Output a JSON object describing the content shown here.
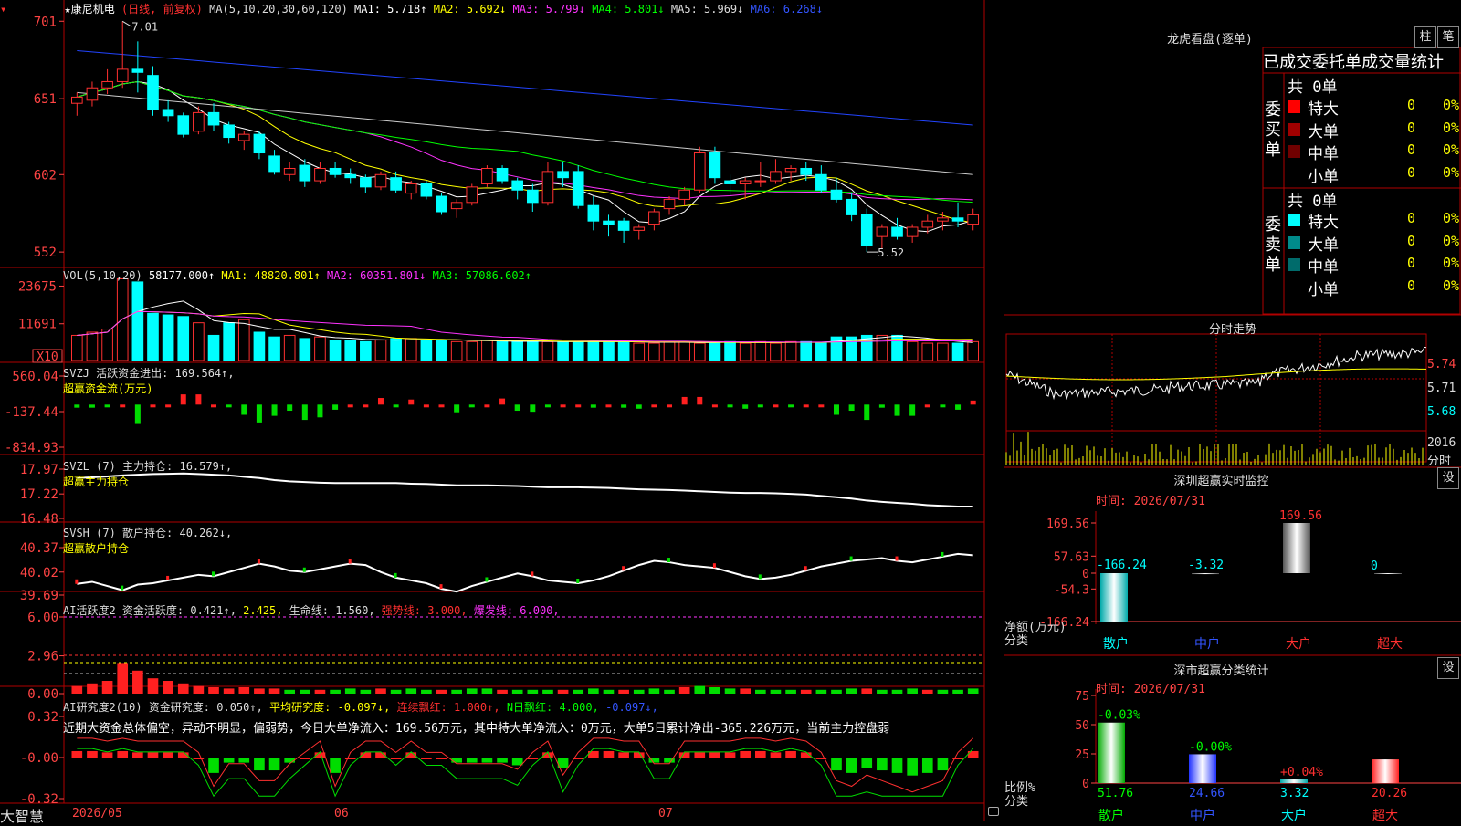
{
  "header": {
    "stock": "★康尼机电",
    "mode": "(日线, 前复权)",
    "ma_title": "MA(5,10,20,30,60,120)",
    "ma1": "MA1: 5.718↑",
    "ma2": "MA2: 5.692↓",
    "ma3": "MA3: 5.799↓",
    "ma4": "MA4: 5.801↓",
    "ma5": "MA5: 5.969↓",
    "ma6": "MA6: 6.268↓",
    "high_label": "7.01",
    "low_label": "5.52"
  },
  "price_axis": [
    "701",
    "651",
    "602",
    "552"
  ],
  "vol": {
    "title": "VOL(5,10,20)",
    "value": "58177.000↑",
    "ma1": "MA1: 48820.801↑",
    "ma2": "MA2: 60351.801↓",
    "ma3": "MA3: 57086.602↑",
    "axis": [
      "23675",
      "11691"
    ],
    "unit": "X10"
  },
  "svzj": {
    "title": "SVZJ  活跃资金进出: 169.564↑,",
    "sub": "超赢资金流(万元)",
    "axis": [
      "560.04",
      "-137.44",
      "-834.93"
    ]
  },
  "svzl": {
    "title": "SVZL (7) 主力持仓: 16.579↑,",
    "sub": "超赢主力持仓",
    "axis": [
      "17.97",
      "17.22",
      "16.48"
    ]
  },
  "svsh": {
    "title": "SVSH (7) 散户持仓: 40.262↓,",
    "sub": "超赢散户持仓",
    "axis": [
      "40.37",
      "40.02",
      "39.69"
    ]
  },
  "ai1": {
    "title": "AI活跃度2 资金活跃度: 0.421↑,",
    "v2": "2.425,",
    "life": "生命线: 1.560,",
    "strong": "强势线: 3.000,",
    "burst": "爆发线: 6.000,",
    "axis": [
      "6.00",
      "2.96",
      "0.00"
    ]
  },
  "ai2": {
    "title": "AI研究度2(10) 资金研究度: 0.050↑,",
    "avg": "平均研究度: -0.097↓,",
    "streak": "连续飘红: 1.000↑,",
    "nday": "N日飘红: 4.000,",
    "last": "-0.097↓,",
    "comment": "近期大资金总体偏空，异动不明显，偏弱势，今日大单净流入：169.56万元，其中特大单净流入：0万元，大单5日累计净出-365.226万元，当前主力控盘弱",
    "axis": [
      "0.32",
      "-0.00",
      "-0.32"
    ]
  },
  "footer": {
    "logo": "大智慧",
    "date1": "2026/05",
    "date2": "06",
    "date3": "07"
  },
  "right": {
    "lhb_title": "龙虎看盘(逐单)",
    "btn_zhu": "柱",
    "btn_bi": "笔",
    "tabs": [
      "已成交",
      "委托单",
      "成交量",
      "统计"
    ],
    "buy_label": "委买单",
    "sell_label": "委卖单",
    "buy_total": "共 0单",
    "sell_total": "共 0单",
    "buy_rows": [
      {
        "name": "特大",
        "count": "0",
        "pct": "0%",
        "color": "#ff0000"
      },
      {
        "name": "大单",
        "count": "0",
        "pct": "0%",
        "color": "#a00000"
      },
      {
        "name": "中单",
        "count": "0",
        "pct": "0%",
        "color": "#700000"
      },
      {
        "name": "小单",
        "count": "0",
        "pct": "0%",
        "color": "#000000"
      }
    ],
    "sell_rows": [
      {
        "name": "特大",
        "count": "0",
        "pct": "0%",
        "color": "#00ffff"
      },
      {
        "name": "大单",
        "count": "0",
        "pct": "0%",
        "color": "#008b8b"
      },
      {
        "name": "中单",
        "count": "0",
        "pct": "0%",
        "color": "#006b6b"
      },
      {
        "name": "小单",
        "count": "0",
        "pct": "0%",
        "color": "#000000"
      }
    ],
    "intraday_title": "分时走势",
    "intraday_axis": [
      "5.74",
      "5.71",
      "5.68"
    ],
    "intraday_vol": "2016",
    "intraday_unit": "分时",
    "sz_title": "深圳超赢实时监控",
    "sz_btn": "设",
    "sz_date": "时间: 2026/07/31",
    "sz_axis": [
      "169.56",
      "57.63",
      "0",
      "-54.3",
      "-166.24"
    ],
    "sz_values": [
      {
        "label": "-166.24"
      },
      {
        "label": "-3.32"
      },
      {
        "label": "169.56"
      },
      {
        "label": "0"
      }
    ],
    "sz_cats": [
      "散户",
      "中户",
      "大户",
      "超大"
    ],
    "sz_ylab": "净额(万元)",
    "sz_xlab": "分类",
    "cls_title": "深市超赢分类统计",
    "cls_btn": "设",
    "cls_date": "时间: 2026/07/31",
    "cls_axis": [
      "75",
      "50",
      "25",
      "0"
    ],
    "cls_changes": [
      "-0.03%",
      "-0.00%",
      "+0.04%",
      ""
    ],
    "cls_values": [
      "51.76",
      "24.66",
      "3.32",
      "20.26"
    ],
    "cls_cats": [
      "散户",
      "中户",
      "大户",
      "超大"
    ],
    "cls_ylab": "比例%",
    "cls_xlab": "分类"
  },
  "chart_data": [
    {
      "type": "candlestick",
      "title": "康尼机电 日线 前复权",
      "ylim": [
        5.45,
        7.1
      ],
      "ohlc": [
        [
          6.48,
          6.55,
          6.4,
          6.52
        ],
        [
          6.5,
          6.62,
          6.46,
          6.58
        ],
        [
          6.58,
          6.7,
          6.54,
          6.62
        ],
        [
          6.62,
          7.01,
          6.58,
          6.7
        ],
        [
          6.7,
          6.88,
          6.55,
          6.68
        ],
        [
          6.66,
          6.72,
          6.4,
          6.44
        ],
        [
          6.44,
          6.5,
          6.36,
          6.4
        ],
        [
          6.4,
          6.42,
          6.26,
          6.28
        ],
        [
          6.3,
          6.46,
          6.28,
          6.42
        ],
        [
          6.42,
          6.48,
          6.3,
          6.34
        ],
        [
          6.34,
          6.36,
          6.22,
          6.26
        ],
        [
          6.24,
          6.3,
          6.18,
          6.28
        ],
        [
          6.28,
          6.3,
          6.12,
          6.16
        ],
        [
          6.14,
          6.18,
          6.02,
          6.04
        ],
        [
          6.02,
          6.1,
          5.98,
          6.06
        ],
        [
          6.08,
          6.12,
          5.94,
          5.98
        ],
        [
          5.98,
          6.1,
          5.96,
          6.06
        ],
        [
          6.06,
          6.1,
          6.0,
          6.02
        ],
        [
          6.02,
          6.06,
          5.96,
          6.0
        ],
        [
          6.0,
          6.02,
          5.9,
          5.94
        ],
        [
          5.94,
          6.04,
          5.92,
          6.02
        ],
        [
          6.0,
          6.04,
          5.9,
          5.92
        ],
        [
          5.9,
          5.98,
          5.86,
          5.96
        ],
        [
          5.96,
          5.98,
          5.86,
          5.88
        ],
        [
          5.88,
          5.9,
          5.76,
          5.78
        ],
        [
          5.8,
          5.86,
          5.74,
          5.84
        ],
        [
          5.84,
          5.96,
          5.82,
          5.94
        ],
        [
          5.96,
          6.08,
          5.94,
          6.06
        ],
        [
          6.06,
          6.08,
          5.96,
          5.98
        ],
        [
          5.98,
          6.0,
          5.86,
          5.92
        ],
        [
          5.92,
          5.96,
          5.78,
          5.84
        ],
        [
          5.84,
          6.1,
          5.82,
          6.04
        ],
        [
          6.04,
          6.1,
          5.94,
          6.0
        ],
        [
          6.04,
          6.08,
          5.8,
          5.82
        ],
        [
          5.82,
          5.88,
          5.66,
          5.72
        ],
        [
          5.72,
          5.76,
          5.62,
          5.7
        ],
        [
          5.72,
          5.74,
          5.58,
          5.66
        ],
        [
          5.66,
          5.7,
          5.6,
          5.68
        ],
        [
          5.7,
          5.8,
          5.66,
          5.78
        ],
        [
          5.8,
          5.88,
          5.76,
          5.86
        ],
        [
          5.86,
          5.94,
          5.82,
          5.92
        ],
        [
          5.92,
          6.2,
          5.9,
          6.16
        ],
        [
          6.16,
          6.2,
          5.96,
          6.0
        ],
        [
          5.98,
          6.02,
          5.88,
          5.96
        ],
        [
          5.96,
          6.0,
          5.86,
          5.98
        ],
        [
          5.98,
          6.1,
          5.94,
          5.98
        ],
        [
          5.98,
          6.12,
          5.96,
          6.04
        ],
        [
          6.04,
          6.08,
          5.98,
          6.06
        ],
        [
          6.06,
          6.1,
          5.98,
          6.02
        ],
        [
          6.02,
          6.08,
          5.9,
          5.92
        ],
        [
          5.92,
          6.0,
          5.84,
          5.86
        ],
        [
          5.86,
          5.9,
          5.72,
          5.76
        ],
        [
          5.76,
          5.8,
          5.52,
          5.56
        ],
        [
          5.62,
          5.7,
          5.54,
          5.68
        ],
        [
          5.68,
          5.74,
          5.6,
          5.62
        ],
        [
          5.62,
          5.7,
          5.58,
          5.68
        ],
        [
          5.68,
          5.76,
          5.64,
          5.72
        ],
        [
          5.72,
          5.78,
          5.66,
          5.74
        ],
        [
          5.74,
          5.84,
          5.68,
          5.72
        ],
        [
          5.7,
          5.8,
          5.66,
          5.76
        ]
      ]
    },
    {
      "type": "bar",
      "title": "VOL(5,10,20)",
      "ylim": [
        0,
        27000
      ],
      "values": [
        8000,
        9000,
        10000,
        26000,
        25000,
        15000,
        14500,
        14000,
        12000,
        8000,
        12000,
        13000,
        9000,
        7500,
        8000,
        7000,
        7500,
        6500,
        6500,
        6000,
        6500,
        7000,
        7000,
        6500,
        6500,
        6000,
        6000,
        6500,
        6000,
        6000,
        6000,
        6000,
        6000,
        6000,
        6000,
        6000,
        6000,
        5500,
        5500,
        6000,
        6000,
        5500,
        5500,
        6000,
        5500,
        6000,
        5500,
        6000,
        6000,
        5500,
        7500,
        7500,
        8000,
        8000,
        8000,
        6000,
        5500,
        5500,
        5500,
        6000
      ]
    },
    {
      "type": "bar",
      "title": "超赢资金流(万元)",
      "ylim": [
        -834.93,
        560.04
      ],
      "values": [
        -60,
        -60,
        -40,
        0,
        -380,
        0,
        0,
        200,
        200,
        0,
        -20,
        -200,
        -350,
        -220,
        -120,
        -300,
        -250,
        -100,
        0,
        0,
        130,
        -50,
        100,
        0,
        0,
        -150,
        -40,
        0,
        120,
        -120,
        -140,
        -40,
        0,
        0,
        -60,
        0,
        -60,
        -80,
        0,
        0,
        150,
        150,
        0,
        -40,
        -80,
        -40,
        0,
        -30,
        0,
        0,
        -200,
        -120,
        -300,
        -60,
        -220,
        -220,
        0,
        -50,
        -100,
        80
      ]
    },
    {
      "type": "line",
      "title": "超赢主力持仓",
      "ylim": [
        16.48,
        17.97
      ],
      "values": [
        17.7,
        17.72,
        17.75,
        17.78,
        17.8,
        17.82,
        17.83,
        17.84,
        17.82,
        17.8,
        17.78,
        17.74,
        17.7,
        17.64,
        17.6,
        17.58,
        17.56,
        17.55,
        17.55,
        17.55,
        17.55,
        17.55,
        17.53,
        17.52,
        17.5,
        17.48,
        17.48,
        17.48,
        17.47,
        17.46,
        17.44,
        17.42,
        17.42,
        17.42,
        17.41,
        17.4,
        17.38,
        17.36,
        17.35,
        17.34,
        17.32,
        17.3,
        17.28,
        17.26,
        17.25,
        17.25,
        17.24,
        17.22,
        17.2,
        17.16,
        17.12,
        17.08,
        17.02,
        16.98,
        16.95,
        16.92,
        16.88,
        16.86,
        16.84,
        16.84
      ]
    },
    {
      "type": "line",
      "title": "超赢散户持仓",
      "ylim": [
        39.69,
        40.37
      ],
      "values": [
        39.85,
        39.88,
        39.82,
        39.76,
        39.84,
        39.86,
        39.9,
        39.94,
        39.98,
        39.96,
        40.02,
        40.08,
        40.14,
        40.1,
        40.04,
        40.02,
        40.06,
        40.1,
        40.14,
        40.12,
        40.02,
        39.94,
        39.9,
        39.86,
        39.78,
        39.74,
        39.82,
        39.88,
        39.94,
        40.0,
        39.96,
        39.9,
        39.88,
        39.86,
        39.9,
        39.96,
        40.04,
        40.12,
        40.18,
        40.16,
        40.12,
        40.1,
        40.08,
        40.02,
        39.96,
        39.92,
        39.94,
        39.98,
        40.04,
        40.1,
        40.14,
        40.18,
        40.2,
        40.22,
        40.18,
        40.16,
        40.2,
        40.24,
        40.28,
        40.26
      ]
    },
    {
      "type": "bar",
      "title": "AI活跃度2",
      "ylim": [
        0,
        6.0
      ],
      "values": [
        0.6,
        0.8,
        1.0,
        2.4,
        1.8,
        1.2,
        1.0,
        0.8,
        0.6,
        0.5,
        0.4,
        0.5,
        0.4,
        0.4,
        0.3,
        0.3,
        0.3,
        0.3,
        0.4,
        0.3,
        0.4,
        0.3,
        0.4,
        0.3,
        0.3,
        0.3,
        0.4,
        0.4,
        0.3,
        0.3,
        0.3,
        0.3,
        0.3,
        0.3,
        0.4,
        0.3,
        0.3,
        0.3,
        0.4,
        0.3,
        0.5,
        0.6,
        0.5,
        0.4,
        0.4,
        0.3,
        0.3,
        0.3,
        0.3,
        0.3,
        0.3,
        0.4,
        0.4,
        0.3,
        0.3,
        0.4,
        0.3,
        0.3,
        0.3,
        0.4
      ]
    },
    {
      "type": "bar",
      "title": "AI研究度2(10)",
      "ylim": [
        -0.32,
        0.32
      ],
      "values": [
        0.05,
        0.05,
        0.04,
        0.05,
        0.04,
        0.04,
        0.04,
        0.04,
        0.0,
        -0.12,
        -0.04,
        -0.04,
        -0.1,
        -0.1,
        -0.04,
        0.0,
        0.04,
        -0.12,
        0.0,
        0.04,
        0.04,
        0.0,
        0.04,
        0.0,
        0.0,
        -0.04,
        -0.04,
        -0.04,
        -0.04,
        -0.06,
        0.0,
        0.04,
        -0.08,
        0.0,
        0.05,
        0.05,
        0.04,
        0.04,
        -0.04,
        -0.04,
        0.04,
        0.04,
        0.04,
        0.04,
        0.05,
        0.05,
        0.04,
        0.05,
        0.04,
        0.0,
        -0.1,
        -0.12,
        -0.08,
        -0.1,
        -0.12,
        -0.14,
        -0.12,
        -0.1,
        0.0,
        0.05
      ]
    },
    {
      "type": "bar",
      "title": "深圳超赢实时监控",
      "categories": [
        "散户",
        "中户",
        "大户",
        "超大"
      ],
      "values": [
        -166.24,
        -3.32,
        169.56,
        0
      ],
      "ylabel": "净额(万元)",
      "ylim": [
        -166.24,
        169.56
      ]
    },
    {
      "type": "bar",
      "title": "深市超赢分类统计",
      "categories": [
        "散户",
        "中户",
        "大户",
        "超大"
      ],
      "values": [
        51.76,
        24.66,
        3.32,
        20.26
      ],
      "ylabel": "比例%",
      "ylim": [
        0,
        75
      ]
    }
  ]
}
